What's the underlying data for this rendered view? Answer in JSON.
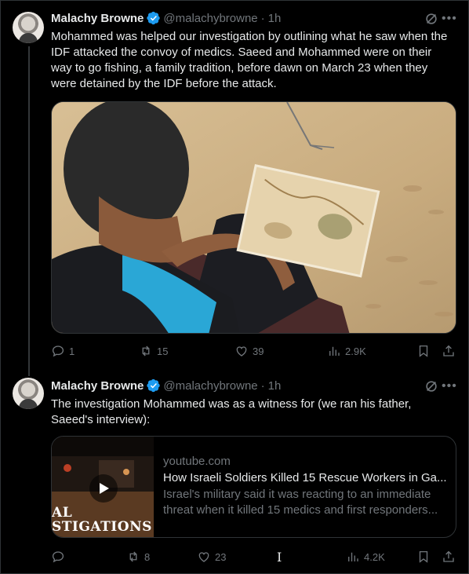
{
  "tweets": [
    {
      "author_name": "Malachy Browne",
      "handle": "@malachybrowne",
      "separator": "·",
      "time": "1h",
      "text": "Mohammed was helped our investigation by outlining what he saw when the IDF attacked the convoy of medics. Saeed and Mohammed were on their way to go fishing, a family tradition, before dawn on March 23 when they were detained by the IDF before the attack.",
      "media_type": "photo",
      "stats": {
        "replies": "1",
        "reposts": "15",
        "likes": "39",
        "views": "2.9K"
      }
    },
    {
      "author_name": "Malachy Browne",
      "handle": "@malachybrowne",
      "separator": "·",
      "time": "1h",
      "text": "The investigation Mohammed was as a witness for (we ran his father, Saeed's interview):",
      "card": {
        "domain": "youtube.com",
        "title": "How Israeli Soldiers Killed 15 Rescue Workers in Ga...",
        "description": "Israel's military said it was reacting to an immediate threat when it killed 15 medics and first responders...",
        "thumb_line1": "AL",
        "thumb_line2": "STIGATIONS"
      },
      "stats": {
        "replies": "",
        "reposts": "8",
        "likes": "23",
        "views": "4.2K"
      }
    }
  ],
  "colors": {
    "background": "#000000",
    "text": "#e7e9ea",
    "muted": "#71767b",
    "verified": "#1d9bf0",
    "border": "#2f3336"
  },
  "icons": [
    "verified-badge-icon",
    "grok-icon",
    "more-icon",
    "reply-icon",
    "repost-icon",
    "like-icon",
    "views-icon",
    "bookmark-icon",
    "share-icon",
    "play-icon"
  ]
}
